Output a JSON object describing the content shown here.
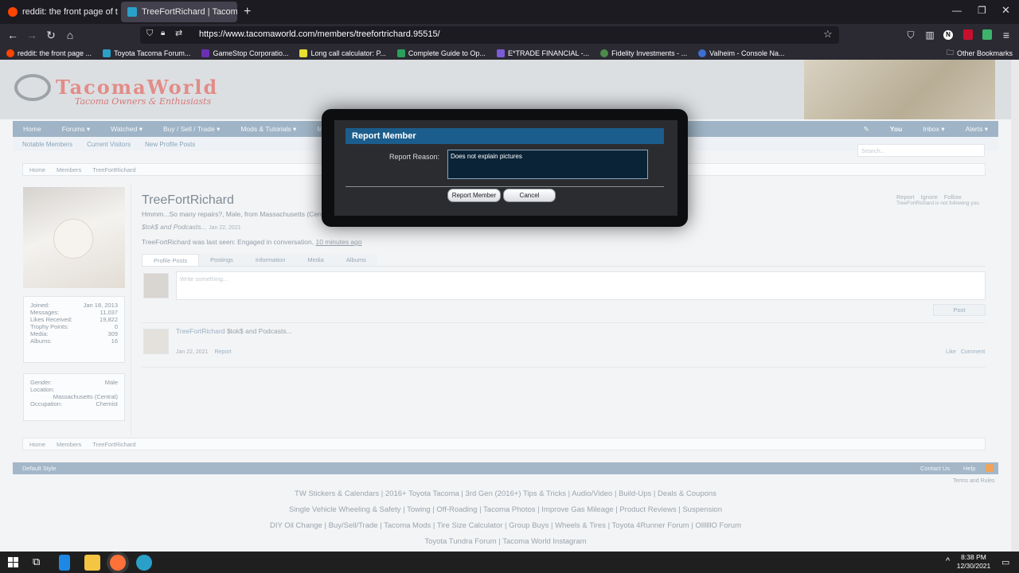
{
  "browser": {
    "tabs": [
      {
        "title": "reddit: the front page of the inte",
        "active": false
      },
      {
        "title": "TreeFortRichard | Tacoma World",
        "active": true
      }
    ],
    "new_tab": "+",
    "url": "https://www.tacomaworld.com/members/treefortrichard.95515/",
    "profile_initial": "N",
    "bookmarks": [
      "reddit: the front page ...",
      "Toyota Tacoma Forum...",
      "GameStop Corporatio...",
      "Long call calculator: P...",
      "Complete Guide to Op...",
      "E*TRADE FINANCIAL -...",
      "Fidelity Investments - ...",
      "Valheim - Console Na..."
    ],
    "other_bookmarks": "Other Bookmarks"
  },
  "site": {
    "logo_text": "TacomaWorld",
    "logo_sub": "Tacoma Owners & Enthusiasts",
    "nav": [
      "Home",
      "Forums ▾",
      "Watched ▾",
      "Buy / Sell / Trade ▾",
      "Mods & Tutorials ▾",
      "Media ▾"
    ],
    "nav_right": [
      "You",
      "Inbox ▾",
      "Alerts ▾"
    ],
    "subnav": [
      "Notable Members",
      "Current Visitors",
      "New Profile Posts"
    ],
    "search_placeholder": "Search...",
    "breadcrumb": [
      "Home",
      "Members",
      "TreeFortRichard"
    ]
  },
  "profile": {
    "name": "TreeFortRichard",
    "blurb": "Hmmm...So many repairs?, Male, from Massachusetts (Central)",
    "status": "$tok$ and Podcasts...",
    "status_date": "Jan 22, 2021",
    "last_seen_prefix": "TreeFortRichard was last seen:",
    "last_seen_activity": "Engaged in conversation,",
    "last_seen_time": "10 minutes ago",
    "actions": [
      "Report",
      "Ignore",
      "Follow"
    ],
    "follow_note": "TreeFortRichard is not following you",
    "tabs": [
      "Profile Posts",
      "Postings",
      "Information",
      "Media",
      "Albums"
    ],
    "write_placeholder": "Write something...",
    "post_button": "Post",
    "stats": [
      {
        "label": "Joined:",
        "value": "Jan 18, 2013"
      },
      {
        "label": "Messages:",
        "value": "11,037"
      },
      {
        "label": "Likes Received:",
        "value": "19,822"
      },
      {
        "label": "Trophy Points:",
        "value": "0"
      },
      {
        "label": "Media:",
        "value": "309"
      },
      {
        "label": "Albums:",
        "value": "16"
      }
    ],
    "details": {
      "gender_label": "Gender:",
      "gender": "Male",
      "location_label": "Location:",
      "location": "Massachusetts (Central)",
      "occupation_label": "Occupation:",
      "occupation": "Chemist"
    },
    "post": {
      "author": "TreeFortRichard",
      "text": "$tok$ and Podcasts...",
      "date": "Jan 22, 2021",
      "report": "Report",
      "like": "Like",
      "comment": "Comment"
    }
  },
  "dialog": {
    "title": "Report Member",
    "reason_label": "Report Reason:",
    "reason_value": "Does not explain pictures",
    "submit": "Report Member",
    "cancel": "Cancel"
  },
  "footer": {
    "style": "Default Style",
    "contact": "Contact Us",
    "help": "Help",
    "terms": "Terms and Rules",
    "links_row1": [
      "TW Stickers & Calendars",
      "2016+ Toyota Tacoma",
      "3rd Gen (2016+) Tips & Tricks",
      "Audio/Video",
      "Build-Ups",
      "Deals & Coupons"
    ],
    "links_row2": [
      "Single Vehicle Wheeling & Safety",
      "Towing",
      "Off-Roading",
      "Tacoma Photos",
      "Improve Gas Mileage",
      "Product Reviews",
      "Suspension"
    ],
    "links_row3": [
      "DIY Oil Change",
      "Buy/Sell/Trade",
      "Tacoma Mods",
      "Tire Size Calculator",
      "Group Buys",
      "Wheels & Tires",
      "Toyota 4Runner Forum",
      "OllllllO Forum"
    ],
    "links_row4": [
      "Toyota Tundra Forum",
      "Tacoma World Instagram"
    ]
  },
  "taskbar": {
    "time": "8:38 PM",
    "date": "12/30/2021"
  }
}
